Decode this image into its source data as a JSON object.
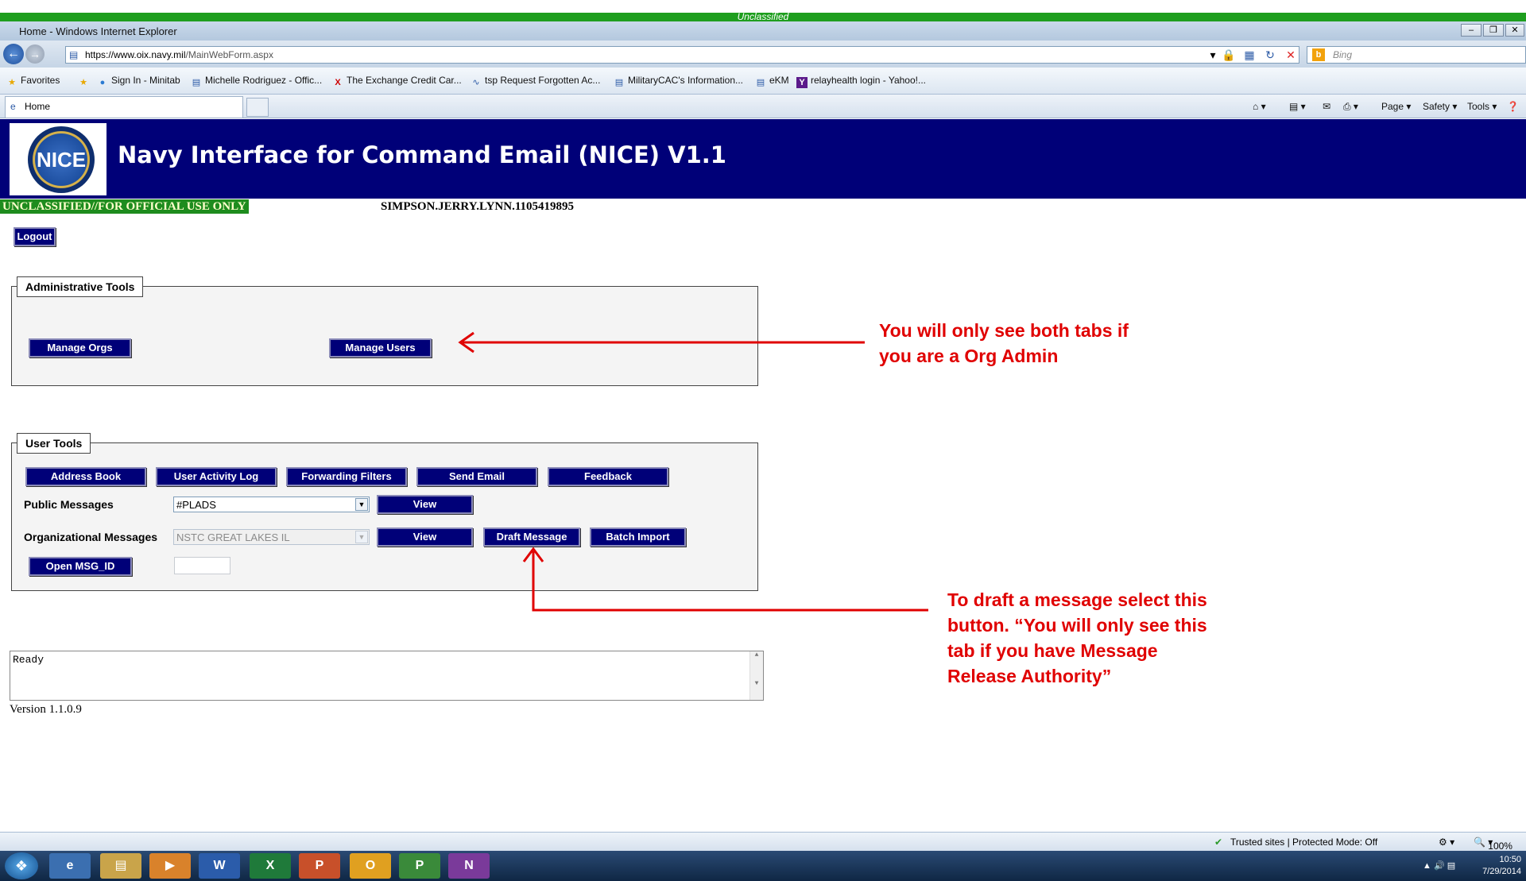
{
  "classification_top": "Unclassified",
  "browser": {
    "title": "Home - Windows Internet Explorer",
    "url_domain": "https://www.oix.navy.mil",
    "url_path": "/MainWebForm.aspx",
    "search_placeholder": "Bing",
    "favorites_label": "Favorites",
    "favorites": [
      "Sign In - Minitab",
      "Michelle Rodriguez - Offic...",
      "The Exchange  Credit Car...",
      "tsp Request Forgotten Ac...",
      "MilitaryCAC's Information...",
      "eKM",
      "relayhealth login - Yahoo!..."
    ],
    "tab_label": "Home",
    "commands": [
      "Page",
      "Safety",
      "Tools"
    ],
    "status_zone": "Trusted sites | Protected Mode: Off",
    "zoom": "100%"
  },
  "banner": {
    "title": "Navy Interface for Command Email (NICE) V1.1",
    "logo_text": "NICE"
  },
  "classification_banner": "UNCLASSIFIED//FOR OFFICIAL USE ONLY",
  "username": "SIMPSON.JERRY.LYNN.1105419895",
  "logout_label": "Logout",
  "admin_tools": {
    "legend": "Administrative Tools",
    "manage_orgs": "Manage Orgs",
    "manage_users": "Manage Users"
  },
  "user_tools": {
    "legend": "User Tools",
    "address_book": "Address Book",
    "user_activity_log": "User Activity Log",
    "forwarding_filters": "Forwarding Filters",
    "send_email": "Send Email",
    "feedback": "Feedback",
    "public_messages_label": "Public Messages",
    "public_messages_value": "#PLADS",
    "view": "View",
    "org_messages_label": "Organizational Messages",
    "org_messages_value": "NSTC GREAT LAKES IL",
    "draft_message": "Draft Message",
    "batch_import": "Batch Import",
    "open_msg_id": "Open MSG_ID",
    "msg_id_value": ""
  },
  "status_text": "Ready",
  "version": "Version 1.1.0.9",
  "annotations": {
    "tabs_note": [
      "You will only see both tabs if",
      "you are a Org Admin"
    ],
    "draft_note": [
      "To draft a message select this",
      "button. “You will only see this",
      "tab if you have Message",
      "Release Authority”"
    ]
  },
  "taskbar": {
    "apps": [
      "Internet Explorer",
      "Windows Explorer",
      "Media Player",
      "Word",
      "Excel",
      "PowerPoint",
      "Outlook",
      "Project",
      "OneNote"
    ],
    "time": "10:50",
    "date": "7/29/2014"
  },
  "colors": {
    "banner": "#000078",
    "classification": "#1e8c1e",
    "annotation": "#e00000"
  }
}
